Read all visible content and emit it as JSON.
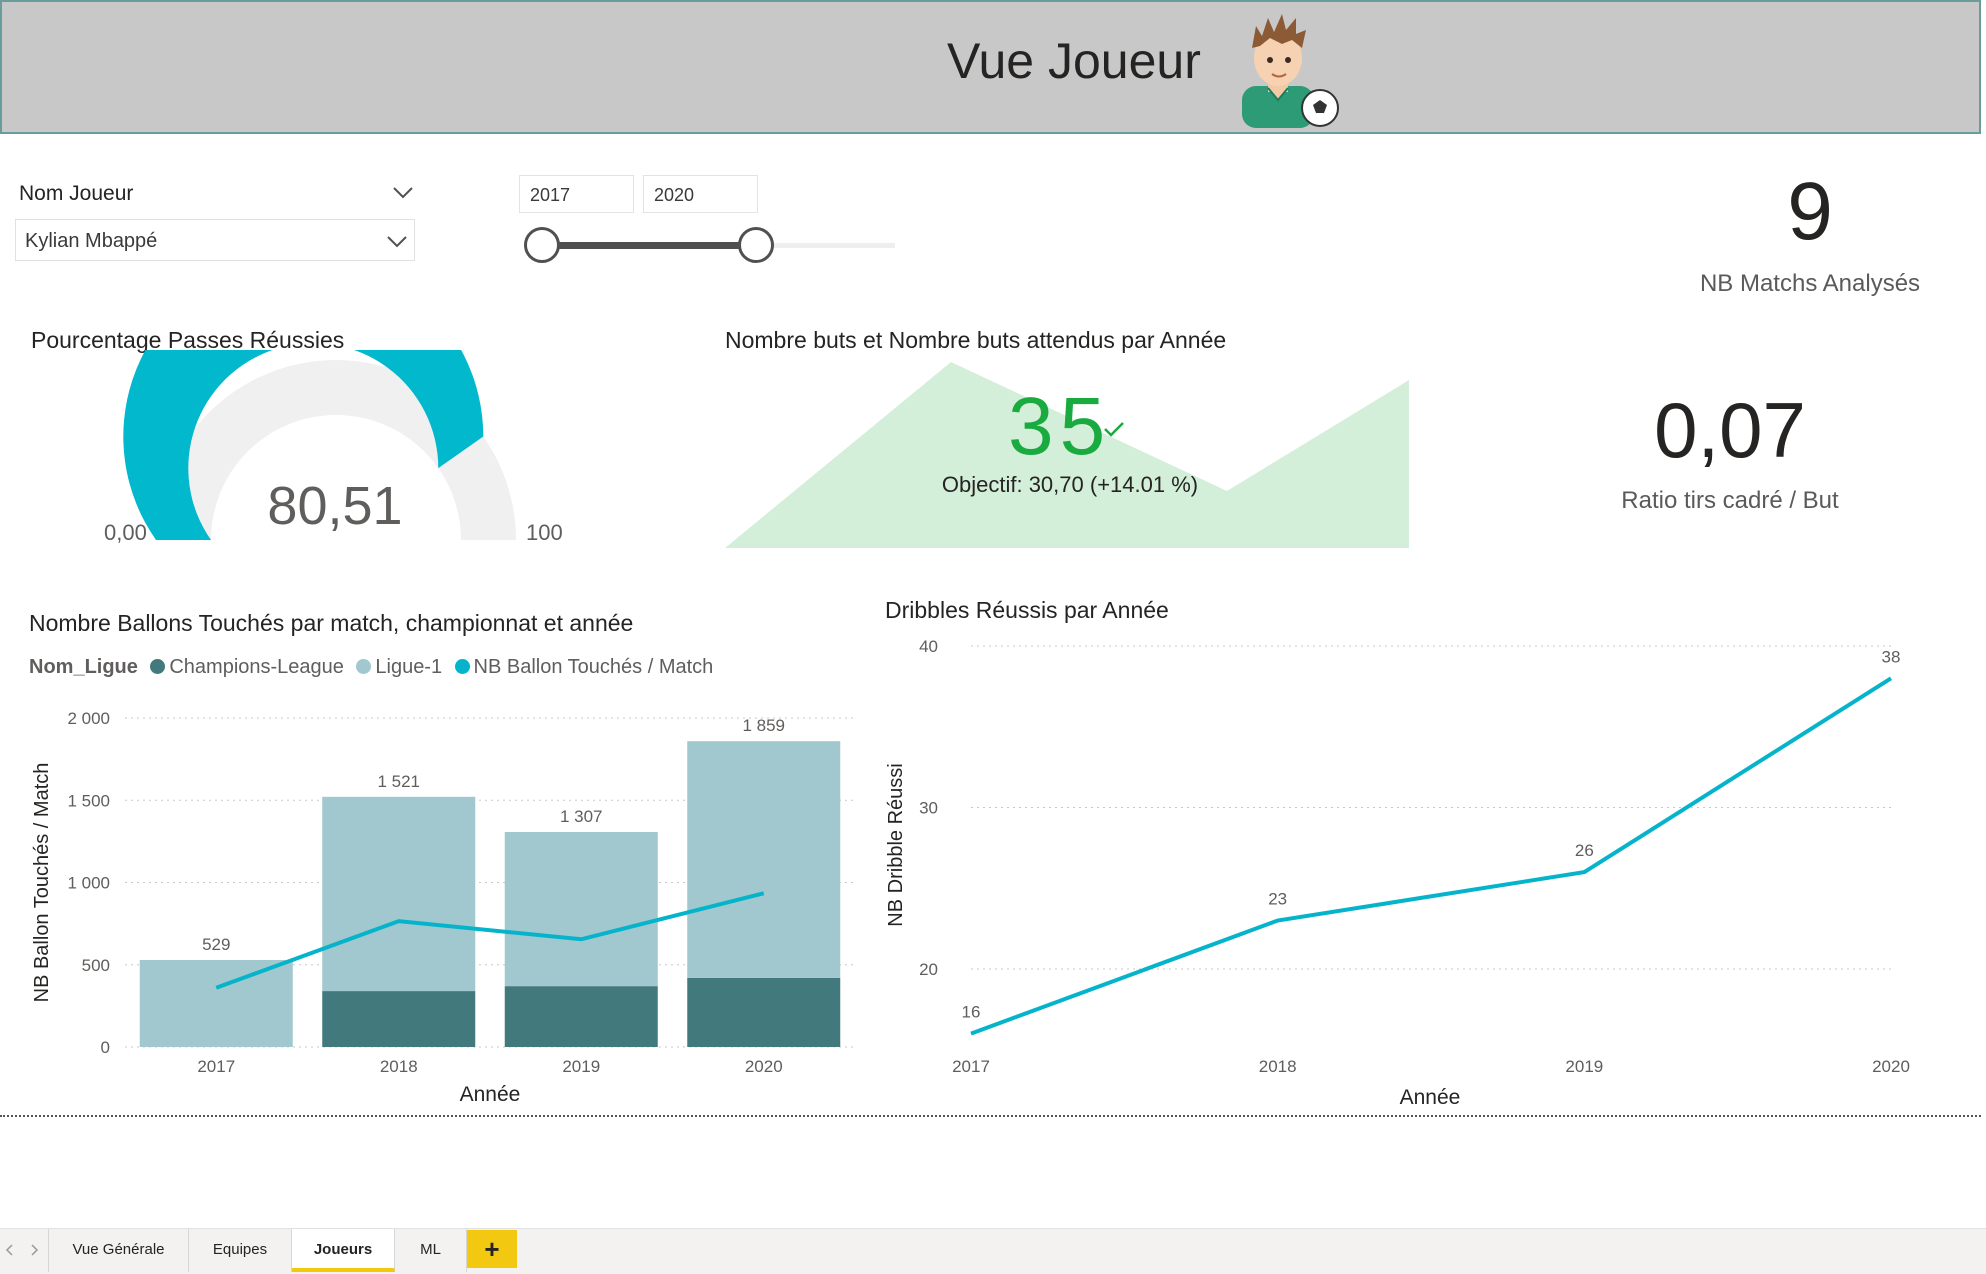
{
  "header": {
    "title": "Vue Joueur",
    "avatar_icon": "soccer-player-avatar"
  },
  "filters": {
    "player_slicer_title": "Nom Joueur",
    "player_selected": "Kylian Mbappé",
    "year_from": "2017",
    "year_to": "2020"
  },
  "kpis": {
    "matches_value": "9",
    "matches_label": "NB Matchs Analysés",
    "ratio_value": "0,07",
    "ratio_label": "Ratio tirs cadré / But"
  },
  "gauge": {
    "title": "Pourcentage Passes Réussies",
    "value": 80.51,
    "value_label": "80,51",
    "min_label": "0,00",
    "max_label": "100",
    "color": "#01b8cc"
  },
  "goals_kpi": {
    "title": "Nombre buts et Nombre buts attendus par Année",
    "value": "35",
    "check_icon": "check-icon",
    "target_text": "Objectif: 30,70 (+14.01 %)",
    "value_color": "#1aab40",
    "area_color": "#d3efd9"
  },
  "ballons_chart": {
    "title": "Nombre Ballons Touchés par match, championnat et année",
    "legend_title": "Nom_Ligue",
    "legend": [
      {
        "name": "Champions-League",
        "color": "#41797d"
      },
      {
        "name": "Ligue-1",
        "color": "#a0c8ce"
      },
      {
        "name": "NB Ballon Touchés / Match",
        "color": "#05b4cb"
      }
    ]
  },
  "dribbles_chart": {
    "title": "Dribbles Réussis par Année"
  },
  "chart_data": [
    {
      "type": "bar",
      "title": "Nombre Ballons Touchés par match, championnat et année",
      "xlabel": "Année",
      "ylabel": "NB Ballon Touchés / Match",
      "ylim": [
        0,
        2000
      ],
      "yticks": [
        "0",
        "500",
        "1 000",
        "1 500",
        "2 000"
      ],
      "ytick_values": [
        0,
        500,
        1000,
        1500,
        2000
      ],
      "categories": [
        "2017",
        "2018",
        "2019",
        "2020"
      ],
      "stacked": true,
      "series": [
        {
          "name": "Champions-League",
          "values": [
            0,
            340,
            370,
            420
          ],
          "color": "#41797d"
        },
        {
          "name": "Ligue-1",
          "values": [
            529,
            1181,
            937,
            1439
          ],
          "color": "#a0c8ce"
        }
      ],
      "totals": [
        529,
        1521,
        1307,
        1859
      ],
      "total_labels": [
        "529",
        "1 521",
        "1 307",
        "1 859"
      ],
      "line": {
        "name": "NB Ballon Touchés / Match",
        "values": [
          360,
          765,
          655,
          935
        ],
        "color": "#05b4cb"
      },
      "grid": true
    },
    {
      "type": "line",
      "title": "Dribbles Réussis par Année",
      "xlabel": "Année",
      "ylabel": "NB Dribble Réussi",
      "ylim": [
        15,
        40
      ],
      "yticks": [
        "20",
        "30",
        "40"
      ],
      "ytick_values": [
        20,
        30,
        40
      ],
      "categories": [
        "2017",
        "2018",
        "2019",
        "2020"
      ],
      "values": [
        16,
        23,
        26,
        38
      ],
      "color": "#05b4cb",
      "grid": true
    }
  ],
  "tabs": [
    {
      "label": "Vue Générale"
    },
    {
      "label": "Equipes"
    },
    {
      "label": "Joueurs"
    },
    {
      "label": "ML"
    }
  ],
  "tab_add_label": "+"
}
